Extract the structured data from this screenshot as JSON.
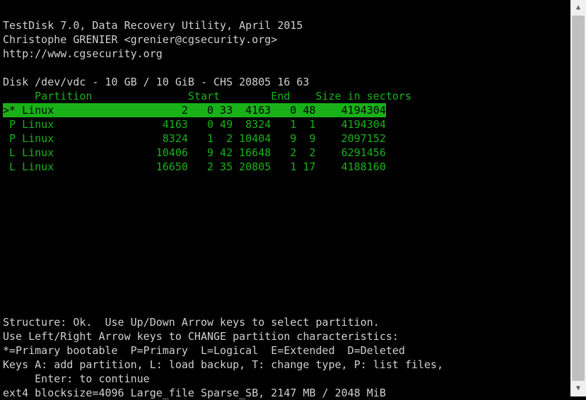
{
  "header": {
    "line1": "TestDisk 7.0, Data Recovery Utility, April 2015",
    "line2": "Christophe GRENIER <grenier@cgsecurity.org>",
    "line3": "http://www.cgsecurity.org"
  },
  "disk_info": "Disk /dev/vdc - 10 GB / 10 GiB - CHS 20805 16 63",
  "table_header": "     Partition               Start        End    Size in sectors",
  "partitions": [
    {
      "selected": true,
      "line": ">* Linux                    2   0 33  4163   0 48    4194304"
    },
    {
      "selected": false,
      "line": " P Linux                 4163   0 49  8324   1  1    4194304"
    },
    {
      "selected": false,
      "line": " P Linux                 8324   1  2 10404   9  9    2097152"
    },
    {
      "selected": false,
      "line": " L Linux                10406   9 42 16648   2  2    6291456"
    },
    {
      "selected": false,
      "line": " L Linux                16650   2 35 20805   1 17    4188160"
    }
  ],
  "footer": {
    "line1": "Structure: Ok.  Use Up/Down Arrow keys to select partition.",
    "line2": "Use Left/Right Arrow keys to CHANGE partition characteristics:",
    "line3": "*=Primary bootable  P=Primary  L=Logical  E=Extended  D=Deleted",
    "line4": "Keys A: add partition, L: load backup, T: change type, P: list files,",
    "line5": "     Enter: to continue",
    "line6": "ext4 blocksize=4096 Large_file Sparse_SB, 2147 MB / 2048 MiB"
  }
}
